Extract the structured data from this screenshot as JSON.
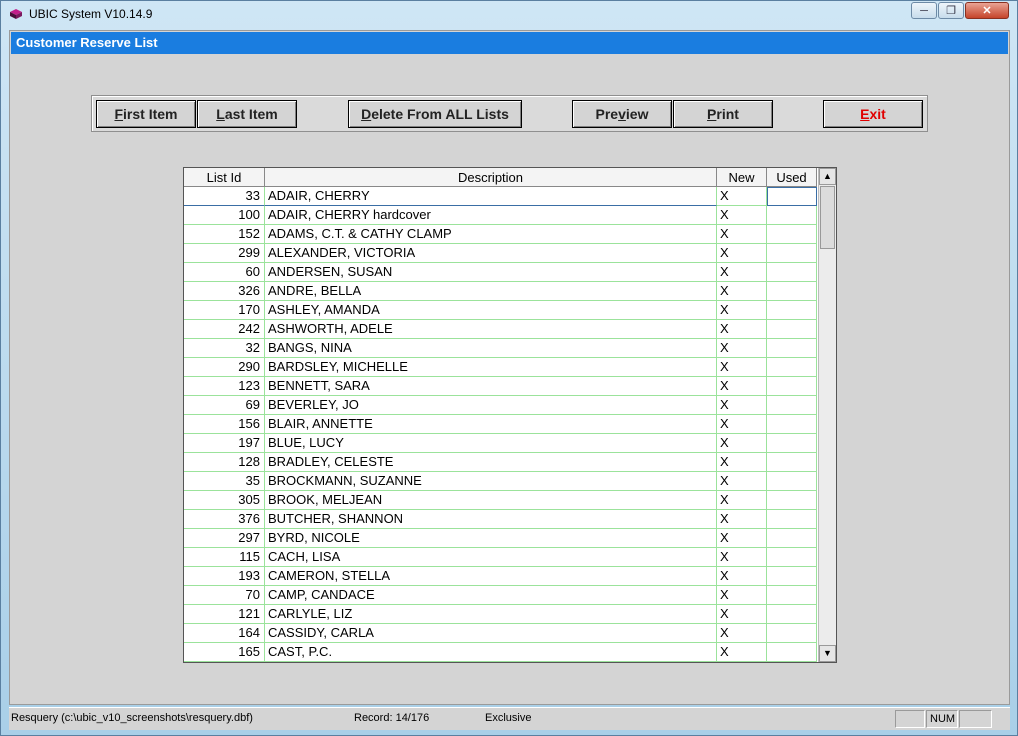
{
  "window": {
    "title": "UBIC System V10.14.9"
  },
  "form": {
    "title": "Customer Reserve List"
  },
  "toolbar": {
    "first_a": "F",
    "first_b": "irst Item",
    "last_a": "L",
    "last_b": "ast Item",
    "delete_a": "D",
    "delete_b": "elete From ALL Lists",
    "preview_a": "Pre",
    "preview_u": "v",
    "preview_b": "iew",
    "print_a": "P",
    "print_b": "rint",
    "exit_a": "E",
    "exit_b": "xit"
  },
  "grid": {
    "headers": {
      "list_id": "List Id",
      "description": "Description",
      "new": "New",
      "used": "Used"
    },
    "rows": [
      {
        "id": "33",
        "desc": "ADAIR, CHERRY",
        "new": "X",
        "used": ""
      },
      {
        "id": "100",
        "desc": "ADAIR, CHERRY hardcover",
        "new": "X",
        "used": ""
      },
      {
        "id": "152",
        "desc": "ADAMS, C.T. & CATHY CLAMP",
        "new": "X",
        "used": ""
      },
      {
        "id": "299",
        "desc": "ALEXANDER, VICTORIA",
        "new": "X",
        "used": ""
      },
      {
        "id": "60",
        "desc": "ANDERSEN, SUSAN",
        "new": "X",
        "used": ""
      },
      {
        "id": "326",
        "desc": "ANDRE, BELLA",
        "new": "X",
        "used": ""
      },
      {
        "id": "170",
        "desc": "ASHLEY, AMANDA",
        "new": "X",
        "used": ""
      },
      {
        "id": "242",
        "desc": "ASHWORTH, ADELE",
        "new": "X",
        "used": ""
      },
      {
        "id": "32",
        "desc": "BANGS, NINA",
        "new": "X",
        "used": ""
      },
      {
        "id": "290",
        "desc": "BARDSLEY, MICHELLE",
        "new": "X",
        "used": ""
      },
      {
        "id": "123",
        "desc": "BENNETT, SARA",
        "new": "X",
        "used": ""
      },
      {
        "id": "69",
        "desc": "BEVERLEY, JO",
        "new": "X",
        "used": ""
      },
      {
        "id": "156",
        "desc": "BLAIR, ANNETTE",
        "new": "X",
        "used": ""
      },
      {
        "id": "197",
        "desc": "BLUE, LUCY",
        "new": "X",
        "used": ""
      },
      {
        "id": "128",
        "desc": "BRADLEY, CELESTE",
        "new": "X",
        "used": ""
      },
      {
        "id": "35",
        "desc": "BROCKMANN, SUZANNE",
        "new": "X",
        "used": ""
      },
      {
        "id": "305",
        "desc": "BROOK, MELJEAN",
        "new": "X",
        "used": ""
      },
      {
        "id": "376",
        "desc": "BUTCHER, SHANNON",
        "new": "X",
        "used": ""
      },
      {
        "id": "297",
        "desc": "BYRD, NICOLE",
        "new": "X",
        "used": ""
      },
      {
        "id": "115",
        "desc": "CACH, LISA",
        "new": "X",
        "used": ""
      },
      {
        "id": "193",
        "desc": "CAMERON, STELLA",
        "new": "X",
        "used": ""
      },
      {
        "id": "70",
        "desc": "CAMP, CANDACE",
        "new": "X",
        "used": ""
      },
      {
        "id": "121",
        "desc": "CARLYLE, LIZ",
        "new": "X",
        "used": ""
      },
      {
        "id": "164",
        "desc": "CASSIDY, CARLA",
        "new": "X",
        "used": ""
      },
      {
        "id": "165",
        "desc": "CAST, P.C.",
        "new": "X",
        "used": ""
      }
    ]
  },
  "status": {
    "file": "Resquery (c:\\ubic_v10_screenshots\\resquery.dbf)",
    "record": "Record: 14/176",
    "mode": "Exclusive",
    "num": "NUM"
  },
  "colors": {
    "title_bar": "#1a7de0",
    "exit_text": "#e00000",
    "grid_lines": "#9be39b"
  },
  "icons": {
    "app": "books-icon",
    "minimize": "minimize-icon",
    "restore": "restore-icon",
    "close": "close-icon"
  }
}
